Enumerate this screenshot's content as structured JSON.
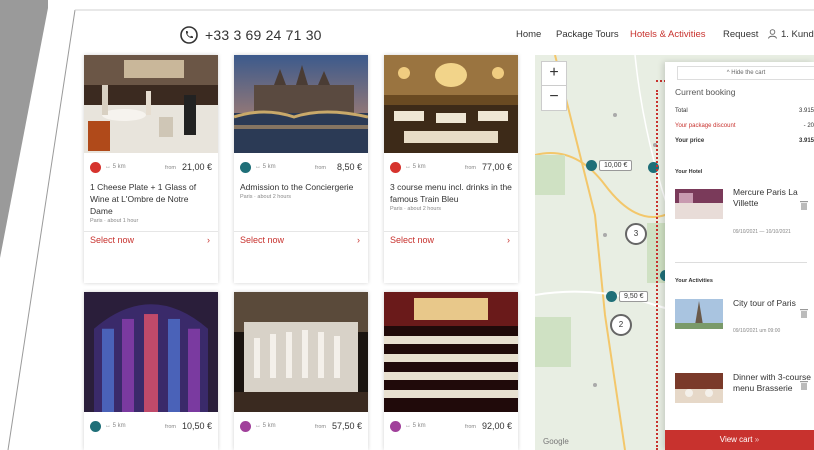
{
  "header": {
    "phone": "+33 3 69 24 71 30",
    "nav": [
      {
        "label": "Home",
        "active": false
      },
      {
        "label": "Package Tours",
        "active": false
      },
      {
        "label": "Hotels & Activities",
        "active": true
      },
      {
        "label": "Request",
        "active": false
      },
      {
        "label": "1. Kund",
        "active": false
      }
    ]
  },
  "cards": [
    {
      "dot_color": "#d6332d",
      "distance": "5 km",
      "from": "from",
      "price": "21,00 €",
      "title": "1 Cheese Plate + 1 Glass of Wine at L'Ombre de Notre Dame",
      "sub": "Paris · about 1 hour",
      "select": "Select now"
    },
    {
      "dot_color": "#1f6f78",
      "distance": "5 km",
      "from": "from",
      "price": "8,50 €",
      "title": "Admission to the Conciergerie",
      "sub": "Paris · about 2 hours",
      "select": "Select now"
    },
    {
      "dot_color": "#d6332d",
      "distance": "5 km",
      "from": "from",
      "price": "77,00 €",
      "title": "3 course menu incl. drinks in the famous Train Bleu",
      "sub": "Paris · about 2 hours",
      "select": "Select now"
    },
    {
      "dot_color": "#1f6f78",
      "distance": "5 km",
      "from": "from",
      "price": "10,50 €"
    },
    {
      "dot_color": "#a0409a",
      "distance": "5 km",
      "from": "from",
      "price": "57,50 €"
    },
    {
      "dot_color": "#a0409a",
      "distance": "5 km",
      "from": "from",
      "price": "92,00 €"
    }
  ],
  "map": {
    "zoom_in": "+",
    "zoom_out": "−",
    "price_tags": [
      "10,00 €",
      "9,50 €"
    ],
    "clusters": [
      "3",
      "2"
    ],
    "google": "Google"
  },
  "cart": {
    "hide": "^ Hide the cart",
    "title": "Current booking",
    "total_label": "Total",
    "total_value": "3.915",
    "discount_label": "Your package discount",
    "discount_value": "- 20",
    "price_label": "Your price",
    "price_value": "3.915",
    "hotel_section": "Your Hotel",
    "hotel_name": "Mercure Paris La Villette",
    "hotel_dates": "09/10/2021 — 10/10/2021",
    "activities_section": "Your Activities",
    "activity1_name": "City tour of Paris",
    "activity1_date": "09/10/2021 um 09:00",
    "activity2_name": "Dinner with 3-course menu Brasserie",
    "view_cart": "View cart",
    "view_cart_arrow": "»"
  },
  "colors": {
    "accent": "#c8322e",
    "marker_teal": "#1f6f78",
    "marker_purple": "#a0409a"
  }
}
